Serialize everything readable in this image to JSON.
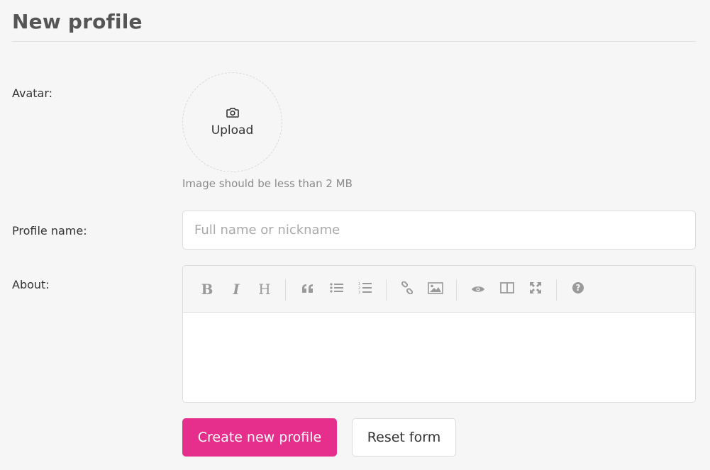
{
  "page": {
    "title": "New profile"
  },
  "avatar": {
    "label": "Avatar:",
    "upload_text": "Upload",
    "upload_icon": "camera-icon",
    "hint": "Image should be less than 2 MB"
  },
  "profile_name": {
    "label": "Profile name:",
    "placeholder": "Full name or nickname",
    "value": ""
  },
  "about": {
    "label": "About:",
    "toolbar": [
      {
        "name": "bold",
        "glyph": "B"
      },
      {
        "name": "italic",
        "glyph": "I"
      },
      {
        "name": "heading",
        "glyph": "H"
      },
      {
        "name": "quote",
        "glyph": "quote-icon"
      },
      {
        "name": "unordered-list",
        "glyph": "list-ul-icon"
      },
      {
        "name": "ordered-list",
        "glyph": "list-ol-icon"
      },
      {
        "name": "link",
        "glyph": "link-icon"
      },
      {
        "name": "image",
        "glyph": "image-icon"
      },
      {
        "name": "preview",
        "glyph": "eye-icon"
      },
      {
        "name": "side-by-side",
        "glyph": "columns-icon"
      },
      {
        "name": "fullscreen",
        "glyph": "expand-icon"
      },
      {
        "name": "guide",
        "glyph": "question-icon"
      }
    ]
  },
  "actions": {
    "create_label": "Create new profile",
    "reset_label": "Reset form"
  },
  "colors": {
    "primary": "#e62e8c",
    "background": "#f6f6f6",
    "icon_gray": "#9a9a9a"
  }
}
